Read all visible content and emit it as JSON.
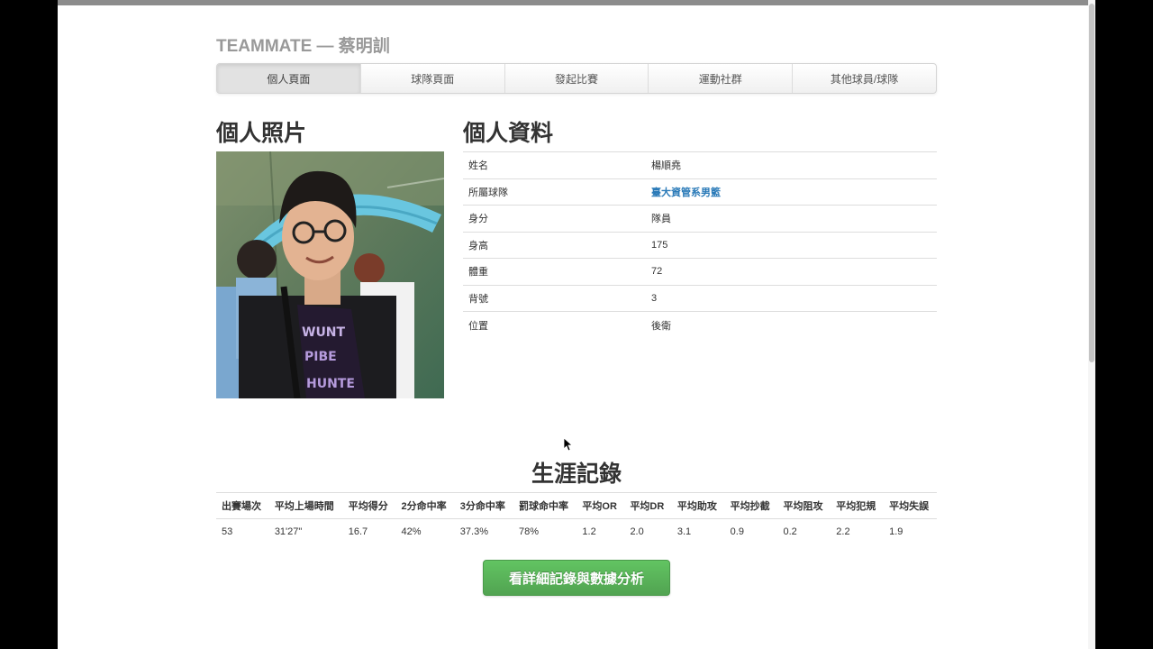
{
  "brand": {
    "title": "TEAMMATE — 蔡明訓"
  },
  "nav": {
    "items": [
      {
        "label": "個人頁面",
        "active": true
      },
      {
        "label": "球隊頁面"
      },
      {
        "label": "發起比賽"
      },
      {
        "label": "運動社群"
      },
      {
        "label": "其他球員/球隊"
      }
    ]
  },
  "photo_section": {
    "heading": "個人照片"
  },
  "info_section": {
    "heading": "個人資料",
    "rows": [
      {
        "key": "姓名",
        "value": "楊順堯"
      },
      {
        "key": "所屬球隊",
        "value": "臺大資管系男籃"
      },
      {
        "key": "身分",
        "value": "隊員"
      },
      {
        "key": "身高",
        "value": "175"
      },
      {
        "key": "體重",
        "value": "72"
      },
      {
        "key": "背號",
        "value": "3"
      },
      {
        "key": "位置",
        "value": "後衛"
      }
    ]
  },
  "career": {
    "heading": "生涯記錄",
    "headers": [
      "出賽場次",
      "平均上場時間",
      "平均得分",
      "2分命中率",
      "3分命中率",
      "罰球命中率",
      "平均OR",
      "平均DR",
      "平均助攻",
      "平均抄截",
      "平均阻攻",
      "平均犯規",
      "平均失誤"
    ],
    "values": [
      "53",
      "31'27\"",
      "16.7",
      "42%",
      "37.3%",
      "78%",
      "1.2",
      "2.0",
      "3.1",
      "0.9",
      "0.2",
      "2.2",
      "1.9"
    ]
  },
  "detail_button": {
    "label": "看詳細記錄與數據分析"
  },
  "colors": {
    "link": "#2a7ab8",
    "button_green": "#5bb75b",
    "brand_gray": "#999999"
  }
}
